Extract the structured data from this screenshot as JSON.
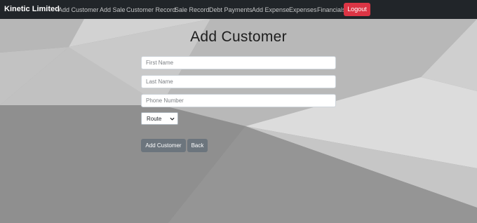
{
  "navbar": {
    "brand": "Kinetic Limited",
    "links": [
      "Add Customer",
      "Add Sale",
      "Customer Record",
      "Sale Record",
      "Debt Payments",
      "Add Expense",
      "Expenses",
      "Financials"
    ],
    "logout_label": "Logout"
  },
  "form": {
    "title": "Add Customer",
    "first_name": {
      "placeholder": "First Name",
      "value": ""
    },
    "last_name": {
      "placeholder": "Last Name",
      "value": ""
    },
    "phone": {
      "placeholder": "Phone Number",
      "value": ""
    },
    "route": {
      "selected": "Route"
    },
    "submit_label": "Add Customer",
    "back_label": "Back"
  },
  "colors": {
    "navbar_bg": "#212529",
    "logout_bg": "#dc3545",
    "button_bg": "#6c757d"
  },
  "icons": {
    "route_dropdown": "chevron-down-icon"
  }
}
